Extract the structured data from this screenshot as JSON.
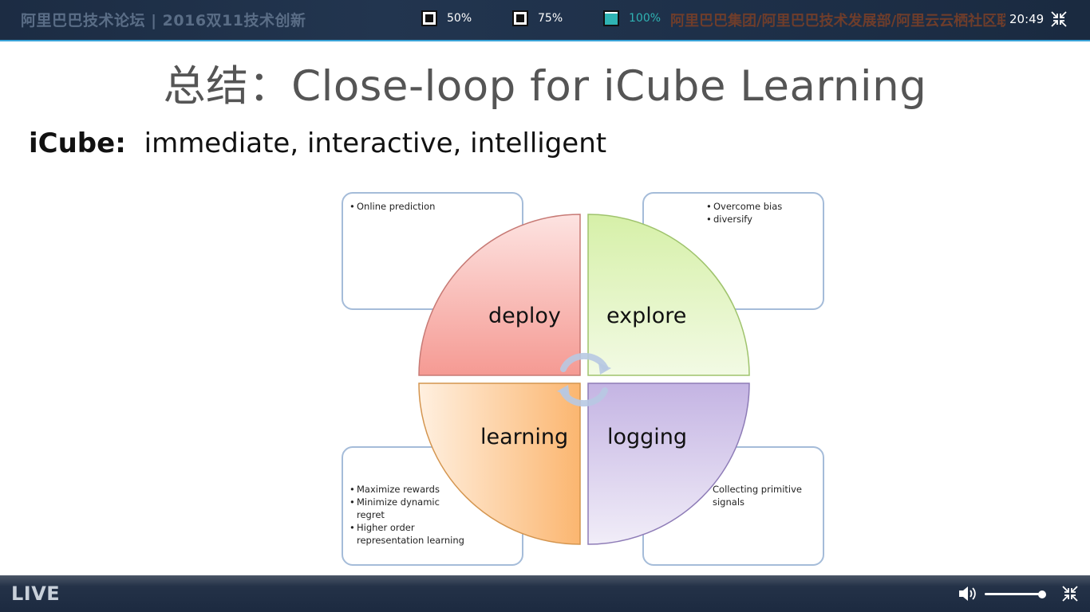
{
  "top_bar": {
    "forum_title": "阿里巴巴技术论坛 | 2016双11技术创新",
    "organizers": "阿里巴巴集团/阿里巴巴技术发展部/阿里云云栖社区联合主办",
    "zoom_options": [
      {
        "label": "50%",
        "active": false
      },
      {
        "label": "75%",
        "active": false
      },
      {
        "label": "100%",
        "active": true
      }
    ],
    "time": "20:49"
  },
  "slide": {
    "title": "总结：Close-loop for iCube Learning",
    "subtitle_bold": "iCube:",
    "subtitle_rest": "immediate, interactive, intelligent",
    "quadrants": {
      "deploy": "deploy",
      "explore": "explore",
      "learning": "learning",
      "logging": "logging"
    },
    "callouts": {
      "top_left": [
        "Online prediction"
      ],
      "top_right": [
        "Overcome bias",
        "diversify"
      ],
      "bottom_left": [
        "Maximize rewards",
        "Minimize dynamic regret",
        "Higher order representation learning"
      ],
      "bottom_right": "Collecting primitive signals"
    },
    "colors": {
      "deploy": "#f6a6a0",
      "explore": "#cdeaa0",
      "learning": "#fbb872",
      "logging": "#cbbde6",
      "callout_border": "#a5bcd9"
    }
  },
  "bottom_bar": {
    "live_label": "LIVE",
    "volume_level": 0.9
  }
}
